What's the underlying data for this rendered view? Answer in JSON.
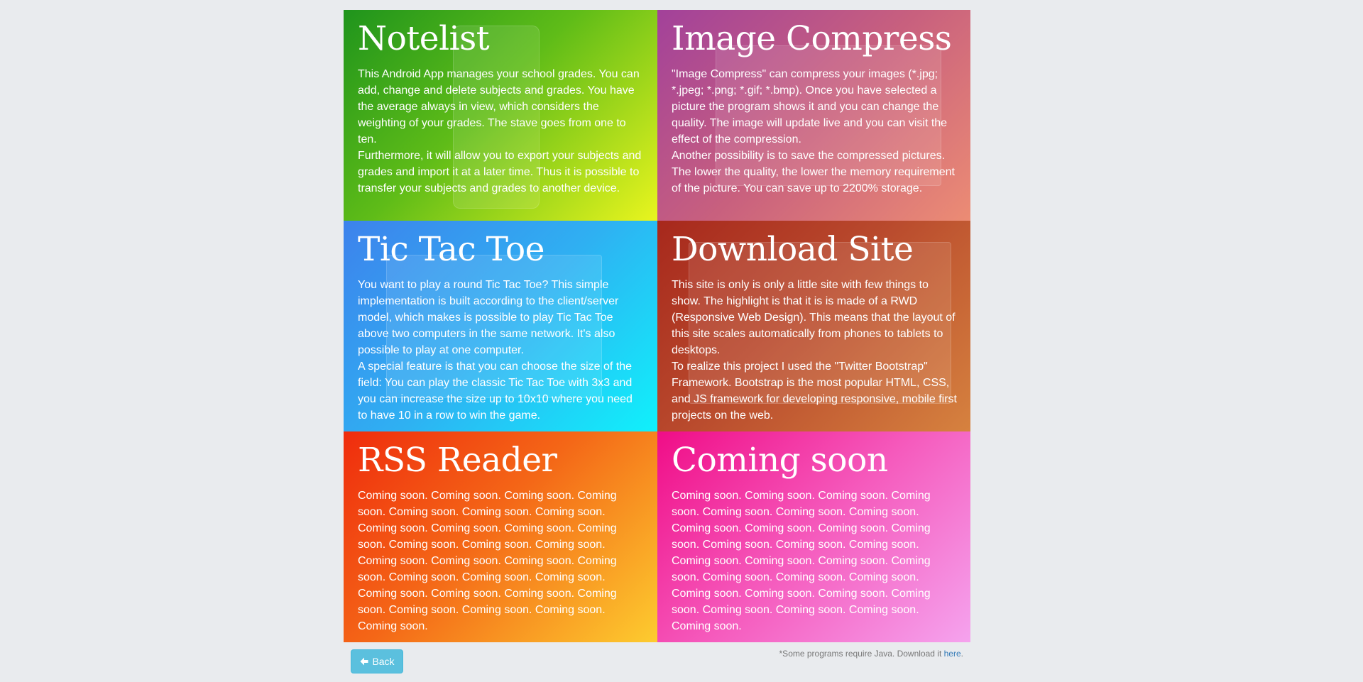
{
  "projects": [
    {
      "title": "Notelist",
      "paragraphs": [
        "This Android App manages your school grades. You can add, change and delete subjects and grades. You have the average always in view, which considers the weighting of your grades. The stave goes from one to ten.",
        "Furthermore, it will allow you to export your subjects and grades and import it at a later time. Thus it is possible to transfer your subjects and grades to another device."
      ]
    },
    {
      "title": "Image Compress",
      "paragraphs": [
        "\"Image Compress\" can compress your images (*.jpg; *.jpeg; *.png; *.gif; *.bmp). Once you have selected a picture the program shows it and you can change the quality. The image will update live and you can visit the effect of the compression.",
        "Another possibility is to save the compressed pictures. The lower the quality, the lower the memory requirement of the picture. You can save up to 2200% storage."
      ]
    },
    {
      "title": "Tic Tac Toe",
      "paragraphs": [
        "You want to play a round Tic Tac Toe? This simple implementation is built according to the client/server model, which makes is possible to play Tic Tac Toe above two computers in the same network. It's also possible to play at one computer.",
        "A special feature is that you can choose the size of the field: You can play the classic Tic Tac Toe with 3x3 and you can increase the size up to 10x10 where you need to have 10 in a row to win the game."
      ]
    },
    {
      "title": "Download Site",
      "paragraphs": [
        "This site is only is only a little site with few things to show. The highlight is that it is is made of a RWD (Responsive Web Design). This means that the layout of this site scales automatically from phones to tablets to desktops.",
        "To realize this project I used the \"Twitter Bootstrap\" Framework. Bootstrap is the most popular HTML, CSS, and JS framework for developing responsive, mobile first projects on the web."
      ]
    },
    {
      "title": "RSS Reader",
      "paragraphs": [
        "Coming soon. Coming soon. Coming soon. Coming soon. Coming soon. Coming soon. Coming soon. Coming soon. Coming soon. Coming soon. Coming soon. Coming soon. Coming soon. Coming soon. Coming soon. Coming soon. Coming soon. Coming soon. Coming soon. Coming soon. Coming soon. Coming soon. Coming soon. Coming soon. Coming soon. Coming soon. Coming soon. Coming soon. Coming soon."
      ]
    },
    {
      "title": "Coming soon",
      "paragraphs": [
        "Coming soon. Coming soon. Coming soon. Coming soon. Coming soon. Coming soon. Coming soon. Coming soon. Coming soon. Coming soon. Coming soon. Coming soon. Coming soon. Coming soon. Coming soon. Coming soon. Coming soon. Coming soon. Coming soon. Coming soon. Coming soon. Coming soon. Coming soon. Coming soon. Coming soon. Coming soon. Coming soon. Coming soon. Coming soon."
      ]
    }
  ],
  "footer": {
    "back_label": "Back",
    "back_icon": "arrow-left-icon",
    "note_text": "*Some programs require Java. Download it ",
    "note_link": "here",
    "note_end": "."
  },
  "colors": {
    "background": "#e9ebee",
    "button": "#5bc0de",
    "link": "#337ab7",
    "notelist": "#5fbc18",
    "image_compress": "#c8607e",
    "tic_tac_toe": "#2fb0f2",
    "download_site": "#b94a2d",
    "rss_reader": "#f46717",
    "coming_soon": "#f55bbd"
  }
}
